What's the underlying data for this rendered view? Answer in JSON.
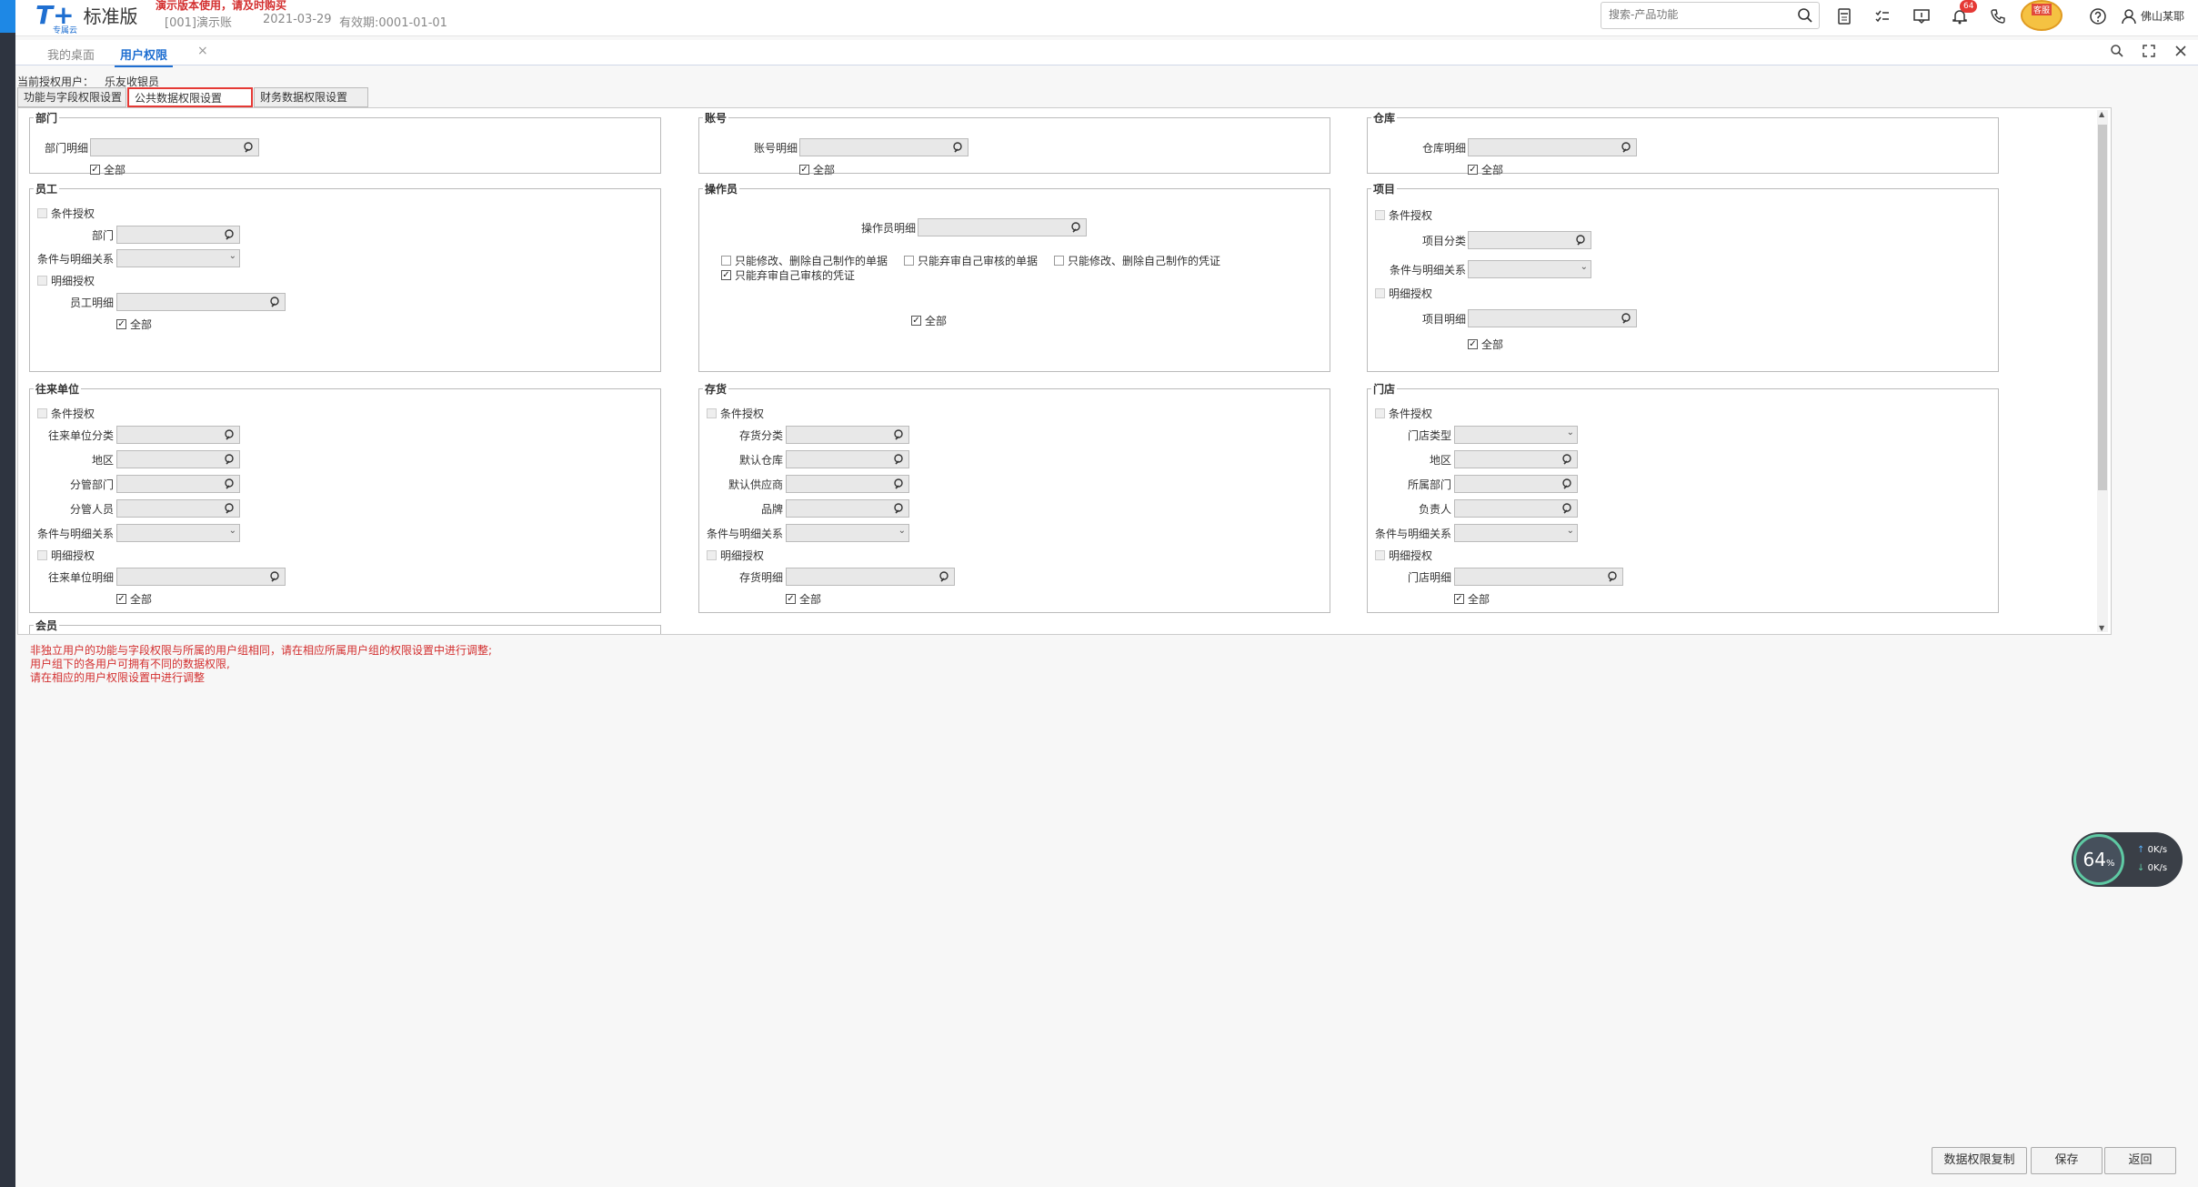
{
  "app": {
    "brand": "T+",
    "brand_sub": "专属云",
    "edition": "标准版",
    "warning": "演示版本使用，请及时购买",
    "account": "[001]演示账",
    "date": "2021-03-29",
    "expire": "有效期:0001-01-01",
    "search_placeholder": "搜索-产品功能",
    "notify_count": "64",
    "avatar_label": "客服",
    "username": "佛山某耶"
  },
  "tabs": [
    {
      "label": "我的桌面"
    },
    {
      "label": "用户权限"
    }
  ],
  "page": {
    "current_user_label": "当前授权用户：",
    "current_user": "乐友收银员",
    "subtabs": [
      "功能与字段权限设置",
      "公共数据权限设置",
      "财务数据权限设置"
    ]
  },
  "groups": {
    "dept": {
      "title": "部门",
      "detail": "部门明细",
      "all": "全部"
    },
    "account": {
      "title": "账号",
      "detail": "账号明细",
      "all": "全部"
    },
    "warehouse": {
      "title": "仓库",
      "detail": "仓库明细",
      "all": "全部"
    },
    "employee": {
      "title": "员工",
      "cond_auth": "条件授权",
      "dept": "部门",
      "relation": "条件与明细关系",
      "detail_auth": "明细授权",
      "detail": "员工明细",
      "all": "全部"
    },
    "operator": {
      "title": "操作员",
      "detail": "操作员明细",
      "opt1": "只能修改、删除自己制作的单据",
      "opt2": "只能弃审自己审核的单据",
      "opt3": "只能修改、删除自己制作的凭证",
      "opt4": "只能弃审自己审核的凭证",
      "all": "全部"
    },
    "project": {
      "title": "项目",
      "cond_auth": "条件授权",
      "category": "项目分类",
      "relation": "条件与明细关系",
      "detail_auth": "明细授权",
      "detail": "项目明细",
      "all": "全部"
    },
    "partner": {
      "title": "往来单位",
      "cond_auth": "条件授权",
      "category": "往来单位分类",
      "region": "地区",
      "dept": "分管部门",
      "staff": "分管人员",
      "relation": "条件与明细关系",
      "detail_auth": "明细授权",
      "detail": "往来单位明细",
      "all": "全部"
    },
    "inventory": {
      "title": "存货",
      "cond_auth": "条件授权",
      "category": "存货分类",
      "warehouse": "默认仓库",
      "supplier": "默认供应商",
      "brand": "品牌",
      "relation": "条件与明细关系",
      "detail_auth": "明细授权",
      "detail": "存货明细",
      "all": "全部"
    },
    "store": {
      "title": "门店",
      "cond_auth": "条件授权",
      "type": "门店类型",
      "region": "地区",
      "dept": "所属部门",
      "manager": "负责人",
      "relation": "条件与明细关系",
      "detail_auth": "明细授权",
      "detail": "门店明细",
      "all": "全部"
    },
    "member": {
      "title": "会员"
    }
  },
  "notes": [
    "非独立用户的功能与字段权限与所属的用户组相同，请在相应所属用户组的权限设置中进行调整;",
    "用户组下的各用户可拥有不同的数据权限,",
    "请在相应的用户权限设置中进行调整"
  ],
  "buttons": {
    "copy": "数据权限复制",
    "save": "保存",
    "back": "返回"
  },
  "speed": {
    "percent": "64",
    "unit": "%",
    "up": "0",
    "down": "0",
    "rate_unit": "K/s"
  }
}
